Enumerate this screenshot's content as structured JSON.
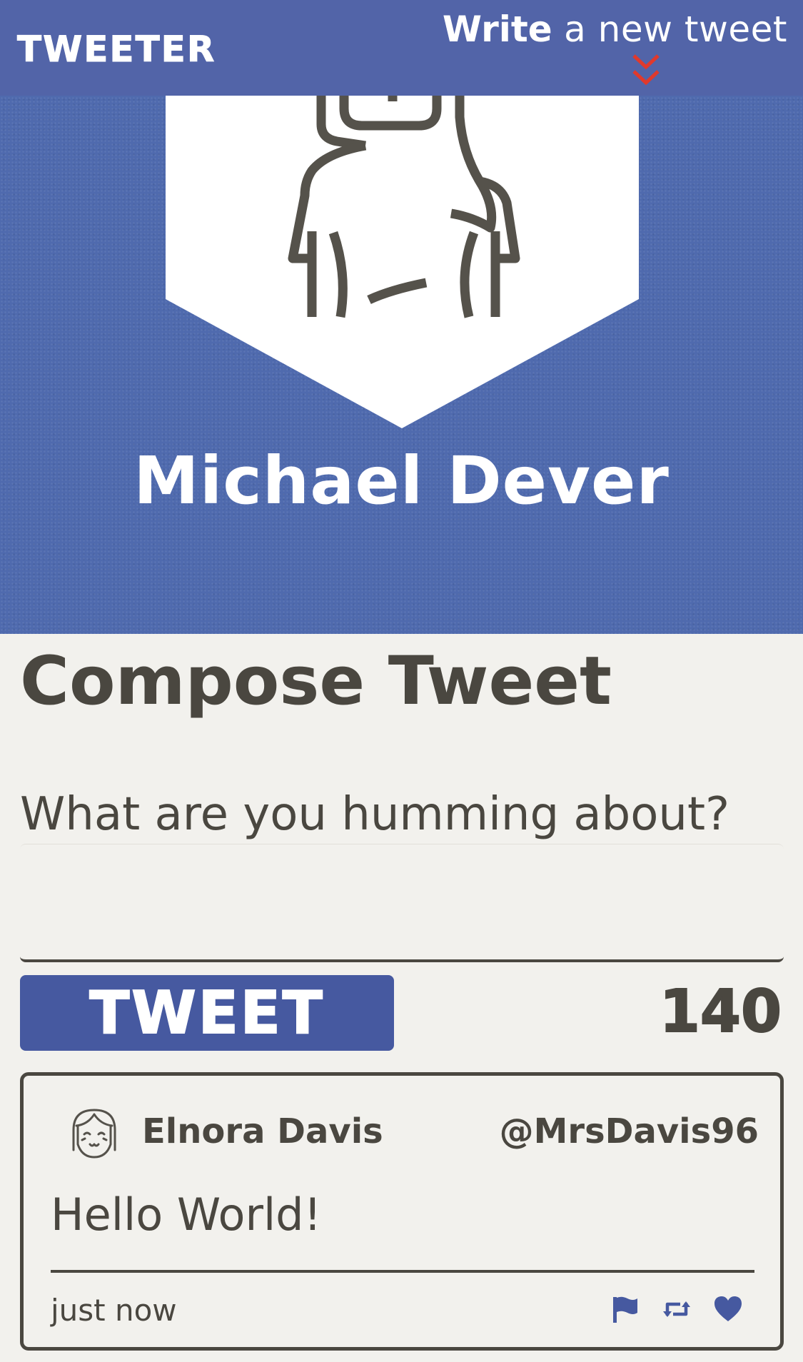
{
  "header": {
    "brand": "TWEETER",
    "write_strong": "Write",
    "write_rest": " a new tweet",
    "chevron_color": "#e0392c"
  },
  "profile": {
    "name": "Michael Dever",
    "avatar_icon": "woman-profile-icon"
  },
  "compose": {
    "title": "Compose Tweet",
    "prompt_label": "What are you humming about?",
    "input_value": "",
    "button_label": "TWEET",
    "char_count": "140"
  },
  "tweets": [
    {
      "author": "Elnora Davis",
      "handle": "@MrsDavis96",
      "text": "Hello World!",
      "time": "just now",
      "avatar_icon": "girl-avatar-icon",
      "actions": [
        "flag-icon",
        "retweet-icon",
        "heart-icon"
      ]
    }
  ],
  "colors": {
    "header_blue": "#5264a8",
    "hero_blue": "#4f6aae",
    "button_blue": "#4659a0",
    "text_dark": "#4a4740",
    "background": "#f2f1ed",
    "accent_red": "#e0392c"
  }
}
